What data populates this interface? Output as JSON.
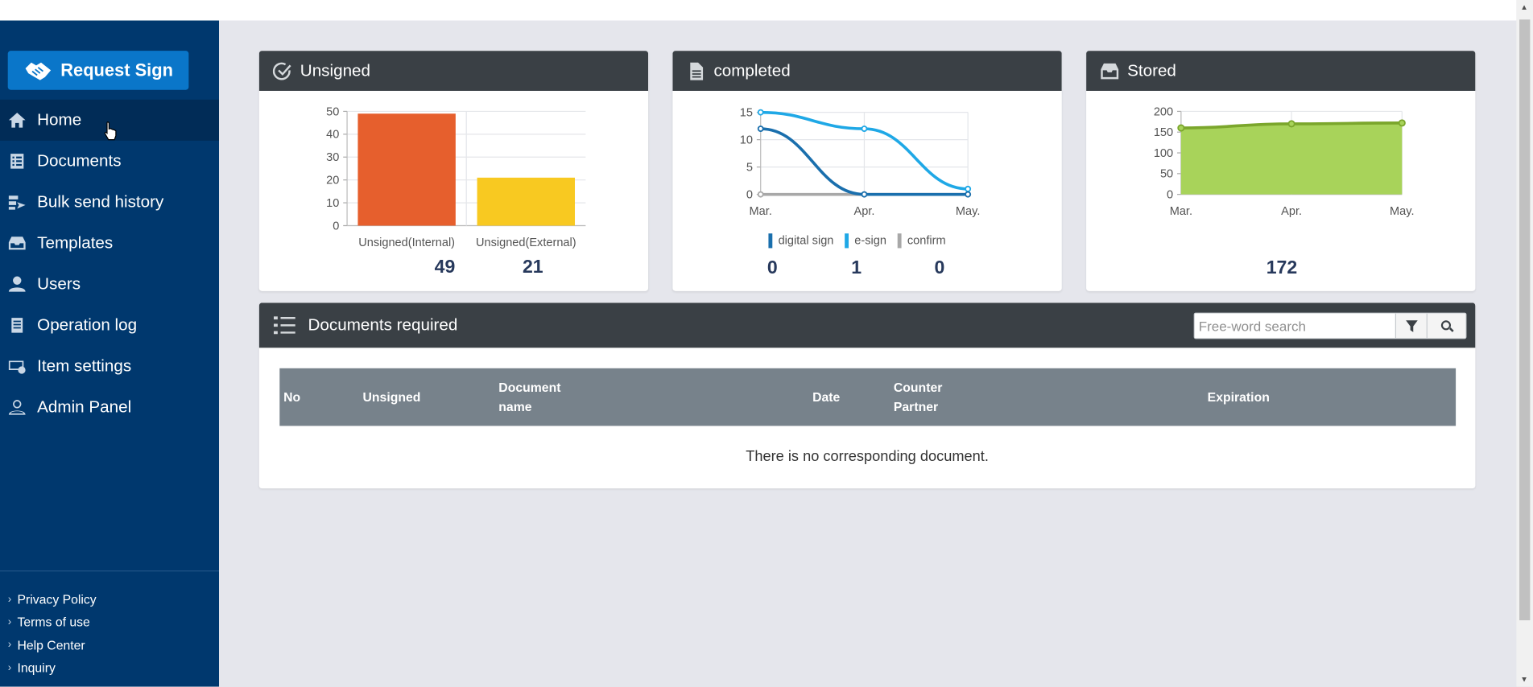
{
  "sidebar": {
    "request_button": "Request Sign",
    "items": [
      {
        "label": "Home",
        "icon": "home-icon"
      },
      {
        "label": "Documents",
        "icon": "documents-icon"
      },
      {
        "label": "Bulk send history",
        "icon": "bulk-send-icon"
      },
      {
        "label": "Templates",
        "icon": "templates-icon"
      },
      {
        "label": "Users",
        "icon": "user-icon"
      },
      {
        "label": "Operation log",
        "icon": "log-icon"
      },
      {
        "label": "Item settings",
        "icon": "item-settings-icon"
      },
      {
        "label": "Admin Panel",
        "icon": "admin-icon"
      }
    ],
    "footer_links": [
      "Privacy Policy",
      "Terms of use",
      "Help Center",
      "Inquiry"
    ]
  },
  "cards": {
    "unsigned": {
      "title": "Unsigned",
      "stats": [
        "49",
        "21"
      ]
    },
    "completed": {
      "title": "completed",
      "stats": [
        "0",
        "1",
        "0"
      ]
    },
    "stored": {
      "title": "Stored",
      "stats": [
        "172"
      ]
    }
  },
  "chart_data": [
    {
      "type": "bar",
      "categories": [
        "Unsigned(Internal)",
        "Unsigned(External)"
      ],
      "values": [
        49,
        21
      ],
      "ylim": [
        0,
        50
      ],
      "yticks": [
        0,
        10,
        20,
        30,
        40,
        50
      ],
      "colors": [
        "#e65f2d",
        "#f8c921"
      ],
      "grid": true
    },
    {
      "type": "line",
      "categories": [
        "Mar.",
        "Apr.",
        "May."
      ],
      "series": [
        {
          "name": "digital sign",
          "values": [
            12,
            0,
            0
          ],
          "color": "#1a6fad"
        },
        {
          "name": "e-sign",
          "values": [
            15,
            12,
            1
          ],
          "color": "#1fa8e6"
        },
        {
          "name": "confirm",
          "values": [
            0,
            0,
            0
          ],
          "color": "#a8a8a8"
        }
      ],
      "ylim": [
        0,
        15
      ],
      "yticks": [
        0,
        5,
        10,
        15
      ],
      "legend": "bottom",
      "grid": true
    },
    {
      "type": "area",
      "categories": [
        "Mar.",
        "Apr.",
        "May."
      ],
      "series": [
        {
          "values": [
            160,
            170,
            172
          ],
          "color": "#7ba62c",
          "fill": "#a8d35a"
        }
      ],
      "ylim": [
        0,
        200
      ],
      "yticks": [
        0,
        50,
        100,
        150,
        200
      ],
      "grid": true
    }
  ],
  "documents": {
    "title": "Documents required",
    "search_placeholder": "Free-word search",
    "columns": [
      "No",
      "Unsigned",
      "Document name",
      "Date",
      "Counter Partner",
      "Expiration"
    ],
    "empty_message": "There is no corresponding document."
  }
}
